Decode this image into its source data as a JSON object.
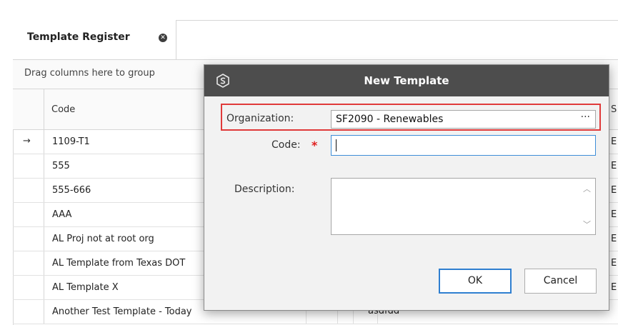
{
  "tab": {
    "label": "Template Register"
  },
  "group_panel": {
    "hint": "Drag columns here to group"
  },
  "grid": {
    "header_code": "Code",
    "header_s": "S",
    "rows": [
      {
        "code": "1109-T1",
        "s": "E",
        "current": true
      },
      {
        "code": "555",
        "s": "E"
      },
      {
        "code": "555-666",
        "s": "E"
      },
      {
        "code": "AAA",
        "s": "E"
      },
      {
        "code": "AL Proj  not at root org",
        "s": "E"
      },
      {
        "code": "AL Template from Texas DOT",
        "s": "E"
      },
      {
        "code": "AL Template X",
        "s": "E"
      },
      {
        "code": "Another Test Template - Today",
        "s": "",
        "extra": "asdfdd"
      }
    ],
    "current_row_marker": "→"
  },
  "dialog": {
    "title": "New Template",
    "organization_label": "Organization:",
    "organization_value": "SF2090 - Renewables",
    "organization_button": "···",
    "code_label": "Code:",
    "required_marker": "*",
    "code_value": "",
    "description_label": "Description:",
    "description_value": "",
    "ok_label": "OK",
    "cancel_label": "Cancel"
  },
  "colors": {
    "title_bar": "#4d4d4d",
    "highlight": "#e03a3a",
    "focus": "#3e8ed8",
    "required": "#e01f1f"
  }
}
